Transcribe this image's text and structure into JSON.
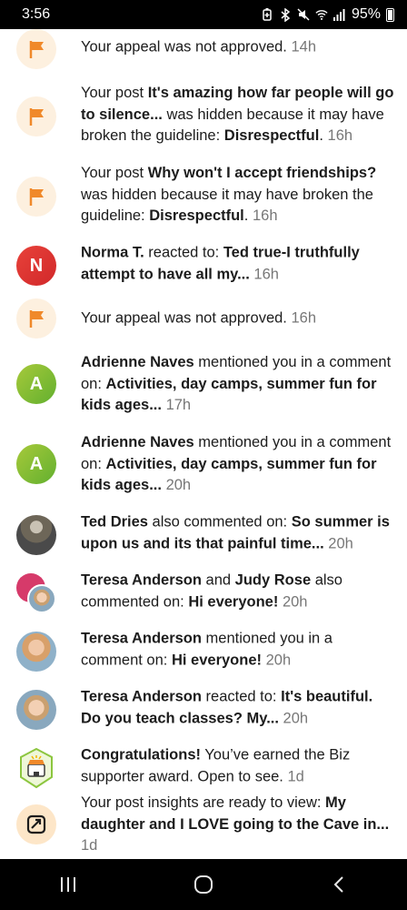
{
  "status_bar": {
    "time": "3:56",
    "battery": "95%",
    "icons": [
      "battery-saver-icon",
      "bluetooth-icon",
      "mute-icon",
      "wifi-icon",
      "signal-icon",
      "battery-icon"
    ]
  },
  "notifications": [
    {
      "avatar": "flag-icon",
      "parts": [
        [
          "Your appeal was not approved.",
          false
        ]
      ],
      "time": "14h"
    },
    {
      "avatar": "flag-icon",
      "parts": [
        [
          "Your post ",
          false
        ],
        [
          "It's amazing how far people will go to silence...",
          true
        ],
        [
          " was hidden because it may have broken the guideline: ",
          false
        ],
        [
          "Disrespectful",
          true
        ],
        [
          ".",
          false
        ]
      ],
      "time": "16h"
    },
    {
      "avatar": "flag-icon",
      "parts": [
        [
          "Your post ",
          false
        ],
        [
          "Why won't I accept friendships?",
          true
        ],
        [
          " was hidden because it may have broken the guideline: ",
          false
        ],
        [
          "Disrespectful",
          true
        ],
        [
          ".",
          false
        ]
      ],
      "time": "16h"
    },
    {
      "avatar": "letter",
      "letter": "N",
      "color": "#e0362f",
      "parts": [
        [
          "Norma T.",
          true
        ],
        [
          " reacted to: ",
          false
        ],
        [
          "Ted true-I truthfully attempt to have all my...",
          true
        ]
      ],
      "time": "16h"
    },
    {
      "avatar": "flag-icon",
      "parts": [
        [
          "Your appeal was not approved.",
          false
        ]
      ],
      "time": "16h"
    },
    {
      "avatar": "letter",
      "letter": "A",
      "color": "#7dbb34",
      "parts": [
        [
          "Adrienne Naves",
          true
        ],
        [
          " mentioned you in a comment on: ",
          false
        ],
        [
          "Activities, day camps, summer fun for kids ages...",
          true
        ]
      ],
      "time": "17h"
    },
    {
      "avatar": "letter",
      "letter": "A",
      "color": "#7dbb34",
      "parts": [
        [
          "Adrienne Naves",
          true
        ],
        [
          " mentioned you in a comment on: ",
          false
        ],
        [
          "Activities, day camps, summer fun for kids ages...",
          true
        ]
      ],
      "time": "20h"
    },
    {
      "avatar": "photo",
      "parts": [
        [
          "Ted Dries",
          true
        ],
        [
          " also commented on: ",
          false
        ],
        [
          "So summer is upon us and its that painful time...",
          true
        ]
      ],
      "time": "20h"
    },
    {
      "avatar": "dual-photo",
      "parts": [
        [
          "Teresa Anderson",
          true
        ],
        [
          " and ",
          false
        ],
        [
          "Judy Rose",
          true
        ],
        [
          " also commented on: ",
          false
        ],
        [
          "Hi everyone!",
          true
        ]
      ],
      "time": "20h"
    },
    {
      "avatar": "photo",
      "parts": [
        [
          "Teresa Anderson",
          true
        ],
        [
          " mentioned you in a comment on: ",
          false
        ],
        [
          "Hi everyone!",
          true
        ]
      ],
      "time": "20h"
    },
    {
      "avatar": "photo",
      "parts": [
        [
          "Teresa Anderson",
          true
        ],
        [
          " reacted to: ",
          false
        ],
        [
          "It's beautiful.  Do you teach classes?  My...",
          true
        ]
      ],
      "time": "20h"
    },
    {
      "avatar": "award-badge-icon",
      "parts": [
        [
          "Congratulations!",
          true
        ],
        [
          " You’ve earned the Biz supporter award. Open to see.",
          false
        ]
      ],
      "time": "1d"
    },
    {
      "avatar": "insights-icon",
      "parts": [
        [
          "Your post insights are ready to view: ",
          false
        ],
        [
          "My daughter and I LOVE going to the Cave in...",
          true
        ]
      ],
      "time": "1d"
    }
  ],
  "nav": [
    "recent-apps-icon",
    "home-icon",
    "back-icon"
  ],
  "colors": {
    "flag": "#f0892a",
    "flag_bg": "#fdf0df",
    "time": "#777777"
  }
}
